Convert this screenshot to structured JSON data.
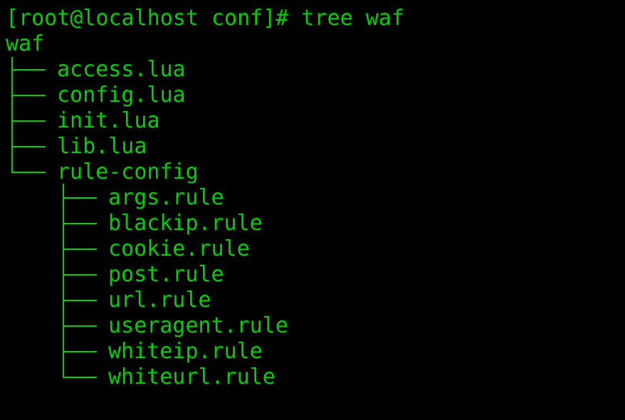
{
  "terminal": {
    "prompt": "[root@localhost conf]# ",
    "command": "tree waf",
    "root_dir": "waf",
    "text_color": "#00d000",
    "background": "#000000",
    "entries": [
      {
        "name": "access.lua"
      },
      {
        "name": "config.lua"
      },
      {
        "name": "init.lua"
      },
      {
        "name": "lib.lua"
      },
      {
        "name": "rule-config"
      }
    ],
    "sub_entries": [
      {
        "name": "args.rule"
      },
      {
        "name": "blackip.rule"
      },
      {
        "name": "cookie.rule"
      },
      {
        "name": "post.rule"
      },
      {
        "name": "url.rule"
      },
      {
        "name": "useragent.rule"
      },
      {
        "name": "whiteip.rule"
      },
      {
        "name": "whiteurl.rule"
      }
    ]
  }
}
